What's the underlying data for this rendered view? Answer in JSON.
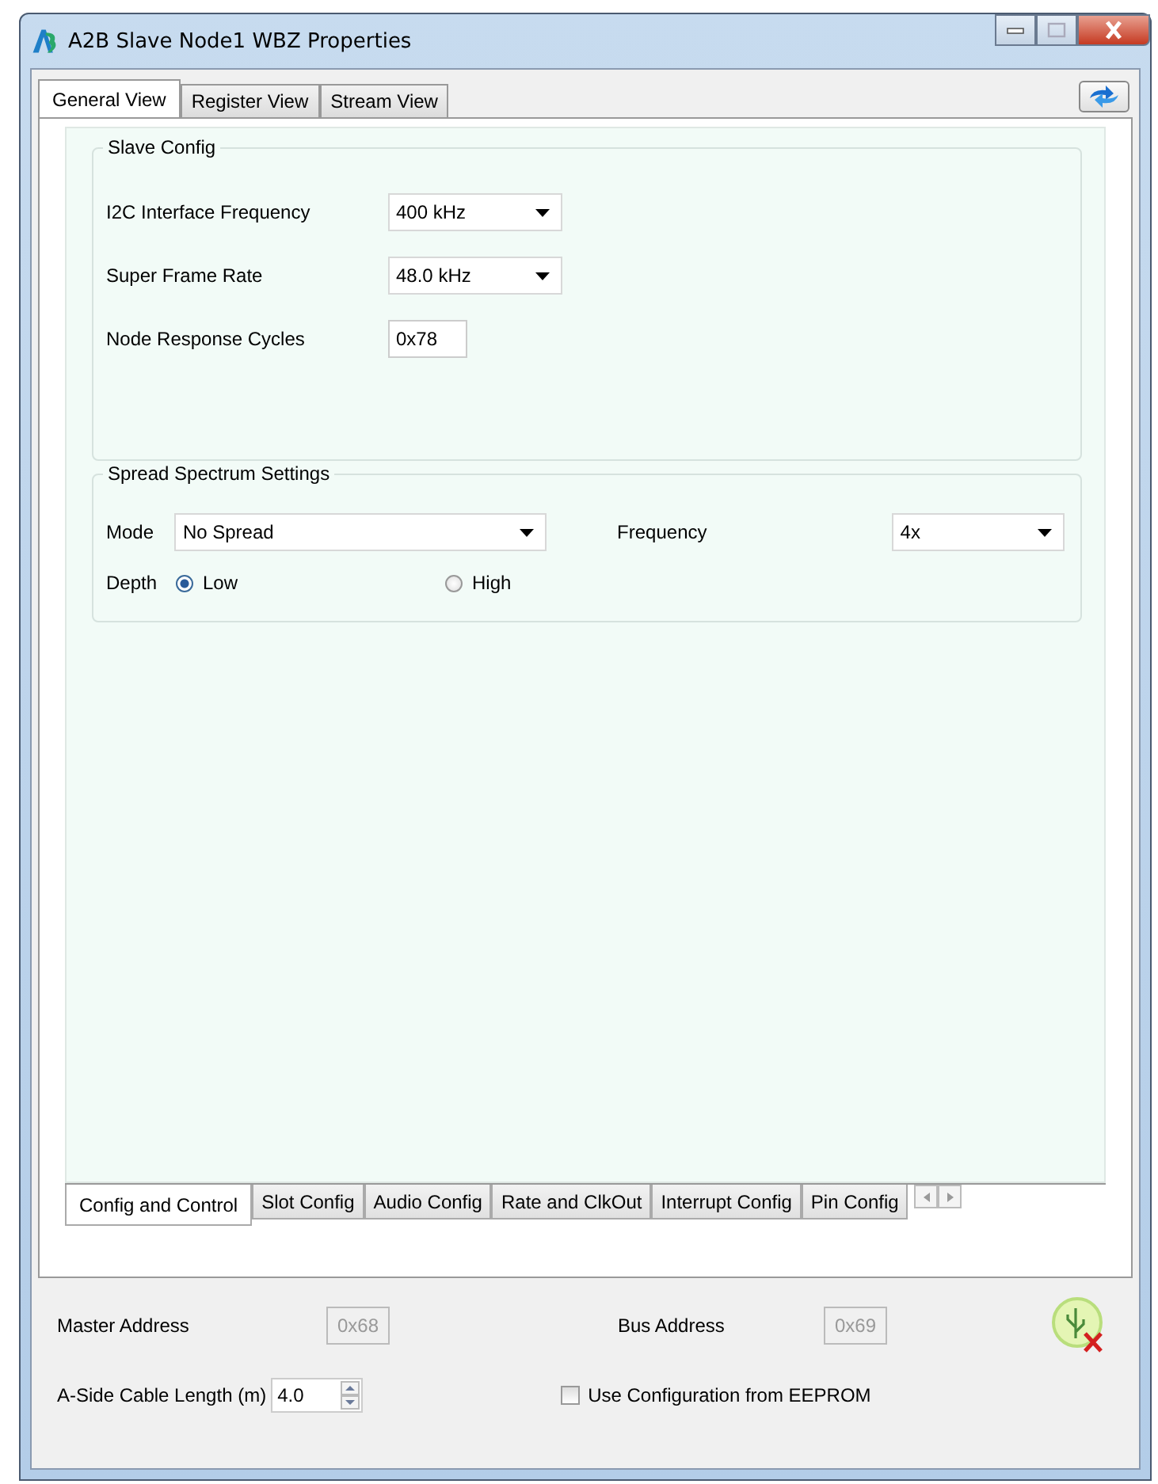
{
  "window": {
    "title": "A2B Slave Node1 WBZ Properties"
  },
  "tabs": [
    {
      "label": "General View",
      "selected": true
    },
    {
      "label": "Register View",
      "selected": false
    },
    {
      "label": "Stream View",
      "selected": false
    }
  ],
  "slave_config": {
    "title": "Slave Config",
    "fields": [
      {
        "kind": "dropdown",
        "label": "I2C Interface Frequency",
        "value": "400 kHz"
      },
      {
        "kind": "dropdown",
        "label": "Super Frame Rate",
        "value": "48.0 kHz"
      },
      {
        "kind": "text",
        "label": "Node Response Cycles",
        "value": "0x78"
      }
    ]
  },
  "spread_spectrum": {
    "title": "Spread Spectrum Settings",
    "mode": {
      "label": "Mode",
      "value": "No Spread"
    },
    "frequency": {
      "label": "Frequency",
      "value": "4x"
    },
    "depth": {
      "label": "Depth",
      "options": [
        {
          "label": "Low",
          "selected": true
        },
        {
          "label": "High",
          "selected": false
        }
      ]
    }
  },
  "sub_tabs": [
    {
      "label": "Config and Control",
      "selected": true
    },
    {
      "label": "Slot Config",
      "selected": false
    },
    {
      "label": "Audio Config",
      "selected": false
    },
    {
      "label": "Rate and ClkOut",
      "selected": false
    },
    {
      "label": "Interrupt Config",
      "selected": false
    },
    {
      "label": "Pin Config",
      "selected": false
    }
  ],
  "master_address": {
    "label": "Master Address",
    "value": "0x68",
    "disabled": true
  },
  "bus_address": {
    "label": "Bus Address",
    "value": "0x69",
    "disabled": true
  },
  "cable_length": {
    "label": "A-Side Cable Length (m)",
    "value": "4.0"
  },
  "use_eeprom": {
    "label": "Use Configuration from EEPROM",
    "checked": false
  }
}
